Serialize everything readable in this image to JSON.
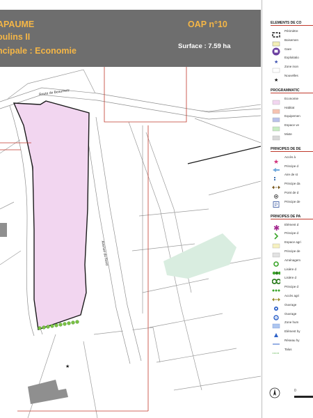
{
  "header": {
    "line1": "APAUME",
    "line2": "oulins II",
    "line3": "ncipale : Economie",
    "oap": "OAP n°10",
    "surface": "Surface : 7.59 ha"
  },
  "map_labels": {
    "road1": "Route de Beaumetz",
    "road2": "Avenue du Nord"
  },
  "legend": {
    "sections": [
      {
        "title": "ELEMENTS DE CO",
        "items": [
          {
            "label": "Périmètre",
            "icon": "perimeter-dashed"
          },
          {
            "label": "Boisemen",
            "icon": "wood-area"
          },
          {
            "label": "Gare",
            "icon": "station-icon"
          },
          {
            "label": "Exploitatio",
            "icon": "farm-star-icon"
          },
          {
            "label": "Zone inon",
            "icon": "flood-zone"
          },
          {
            "label": "Nouvelles",
            "icon": "new-star-icon"
          }
        ]
      },
      {
        "title": "PROGRAMMATIC",
        "items": [
          {
            "label": "Economie",
            "icon": "swatch",
            "color": "#f2d6f0"
          },
          {
            "label": "Habitat",
            "icon": "swatch",
            "color": "#f6c3b1"
          },
          {
            "label": "Equipemen",
            "icon": "swatch",
            "color": "#b9c1ea"
          },
          {
            "label": "Espace ve",
            "icon": "swatch",
            "color": "#c7ecc2"
          },
          {
            "label": "Mixte",
            "icon": "swatch",
            "color": "#d9d9d9"
          }
        ]
      },
      {
        "title": "PRINCIPES DE DE",
        "items": [
          {
            "label": "Accès à",
            "icon": "access-star-icon"
          },
          {
            "label": "Principe d",
            "icon": "arrow-icon"
          },
          {
            "label": "Aire de st",
            "icon": "dots-icon"
          },
          {
            "label": "Principe da",
            "icon": "double-arrow-icon"
          },
          {
            "label": "Point de d",
            "icon": "point-icon"
          },
          {
            "label": "Principe de",
            "icon": "parking-icon"
          }
        ]
      },
      {
        "title": "PRINCIPES DE PA",
        "items": [
          {
            "label": "Elément d",
            "icon": "asterisk-icon"
          },
          {
            "label": "Principe d",
            "icon": "chevron-icon"
          },
          {
            "label": "Espace agri",
            "icon": "swatch-yellow"
          },
          {
            "label": "Principe de",
            "icon": "swatch-grey"
          },
          {
            "label": "Aménagem",
            "icon": "ring-icon"
          },
          {
            "label": "Lisière d",
            "icon": "hedge-icon"
          },
          {
            "label": "Lisière d",
            "icon": "double-ring-icon"
          },
          {
            "label": "Principe d",
            "icon": "green-dots-icon"
          },
          {
            "label": "Accès agri",
            "icon": "agri-arrow-icon"
          },
          {
            "label": "Ouvrage",
            "icon": "blue-circle-icon"
          },
          {
            "label": "Ouvrage",
            "icon": "blue-ring-icon"
          },
          {
            "label": "Zone hum",
            "icon": "wet-zone-icon"
          },
          {
            "label": "Elément hy",
            "icon": "triangle-icon"
          },
          {
            "label": "Réseau hy",
            "icon": "line-icon"
          },
          {
            "label": "Talus",
            "icon": "dotted-line-icon"
          }
        ]
      }
    ],
    "scale_label": "0"
  },
  "colors": {
    "header_bg": "#6e6e6e",
    "header_text": "#f5b646",
    "economy_zone": "#f2d6f0",
    "perimeter": "#c0392b",
    "hedge": "#7ac143"
  }
}
